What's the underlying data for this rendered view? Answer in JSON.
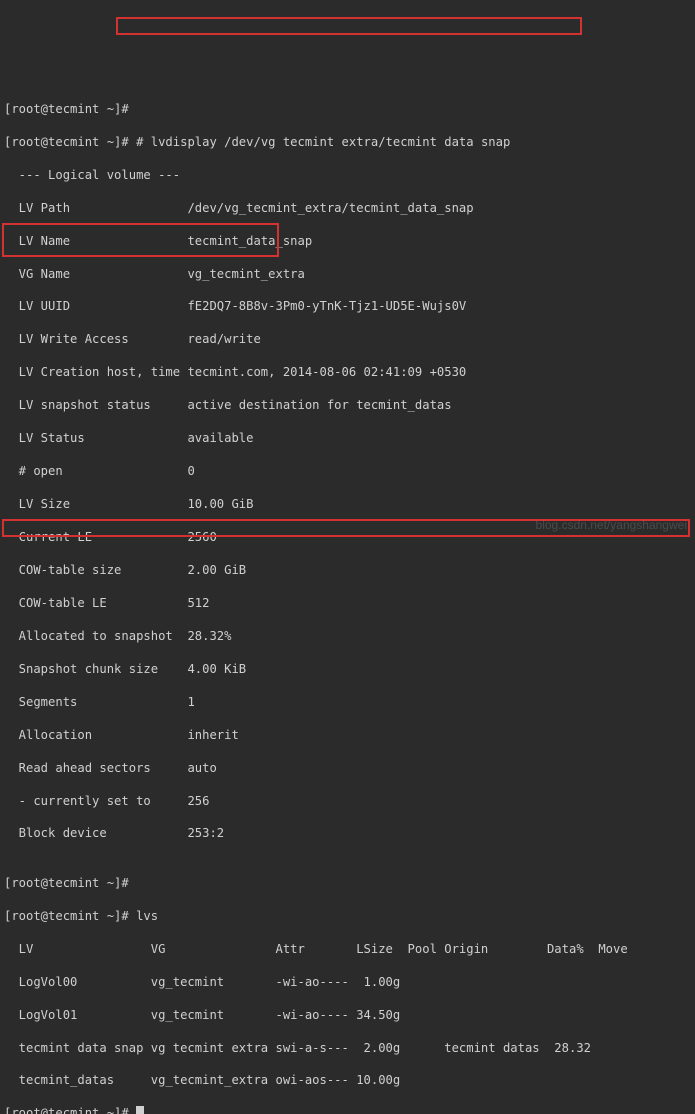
{
  "prompt1_full": "[root@tecmint ~]# ",
  "cmd_lvdisplay": "# lvdisplay /dev/vg tecmint extra/tecmint data snap",
  "lv_header": "  --- Logical volume ---",
  "lv_rows": [
    {
      "label": "  LV Path                ",
      "value": "/dev/vg_tecmint_extra/tecmint_data_snap"
    },
    {
      "label": "  LV Name                ",
      "value": "tecmint_data_snap"
    },
    {
      "label": "  VG Name                ",
      "value": "vg_tecmint_extra"
    },
    {
      "label": "  LV UUID                ",
      "value": "fE2DQ7-8B8v-3Pm0-yTnK-Tjz1-UD5E-Wujs0V"
    },
    {
      "label": "  LV Write Access        ",
      "value": "read/write"
    },
    {
      "label": "  LV Creation host, time ",
      "value": "tecmint.com, 2014-08-06 02:41:09 +0530"
    },
    {
      "label": "  LV snapshot status     ",
      "value": "active destination for tecmint_datas"
    },
    {
      "label": "  LV Status              ",
      "value": "available"
    },
    {
      "label": "  # open                 ",
      "value": "0"
    },
    {
      "label": "  LV Size                ",
      "value": "10.00 GiB"
    },
    {
      "label": "  Current LE             ",
      "value": "2560"
    },
    {
      "label": "  COW-table size         ",
      "value": "2.00 GiB"
    },
    {
      "label": "  COW-table LE           ",
      "value": "512"
    },
    {
      "label": "  Allocated to snapshot  ",
      "value": "28.32%"
    },
    {
      "label": "  Snapshot chunk size    ",
      "value": "4.00 KiB"
    },
    {
      "label": "  Segments               ",
      "value": "1"
    },
    {
      "label": "  Allocation             ",
      "value": "inherit"
    },
    {
      "label": "  Read ahead sectors     ",
      "value": "auto"
    },
    {
      "label": "  - currently set to     ",
      "value": "256"
    },
    {
      "label": "  Block device           ",
      "value": "253:2"
    }
  ],
  "blank": "",
  "prompt_empty": "[root@tecmint ~]# ",
  "cmd_lvs": "[root@tecmint ~]# lvs",
  "lvs_header": "  LV                VG               Attr       LSize  Pool Origin        Data%  Move ",
  "lvs_rows": [
    "  LogVol00          vg_tecmint       -wi-ao----  1.00g                                    ",
    "  LogVol01          vg_tecmint       -wi-ao---- 34.50g                                    ",
    "  tecmint data snap vg tecmint extra swi-a-s---  2.00g      tecmint datas  28.32          ",
    "  tecmint_datas     vg_tecmint_extra owi-aos--- 10.00g                                    "
  ],
  "prompt_final": "[root@tecmint ~]# ",
  "watermark": "blog.csdn.net/yangshangwei"
}
